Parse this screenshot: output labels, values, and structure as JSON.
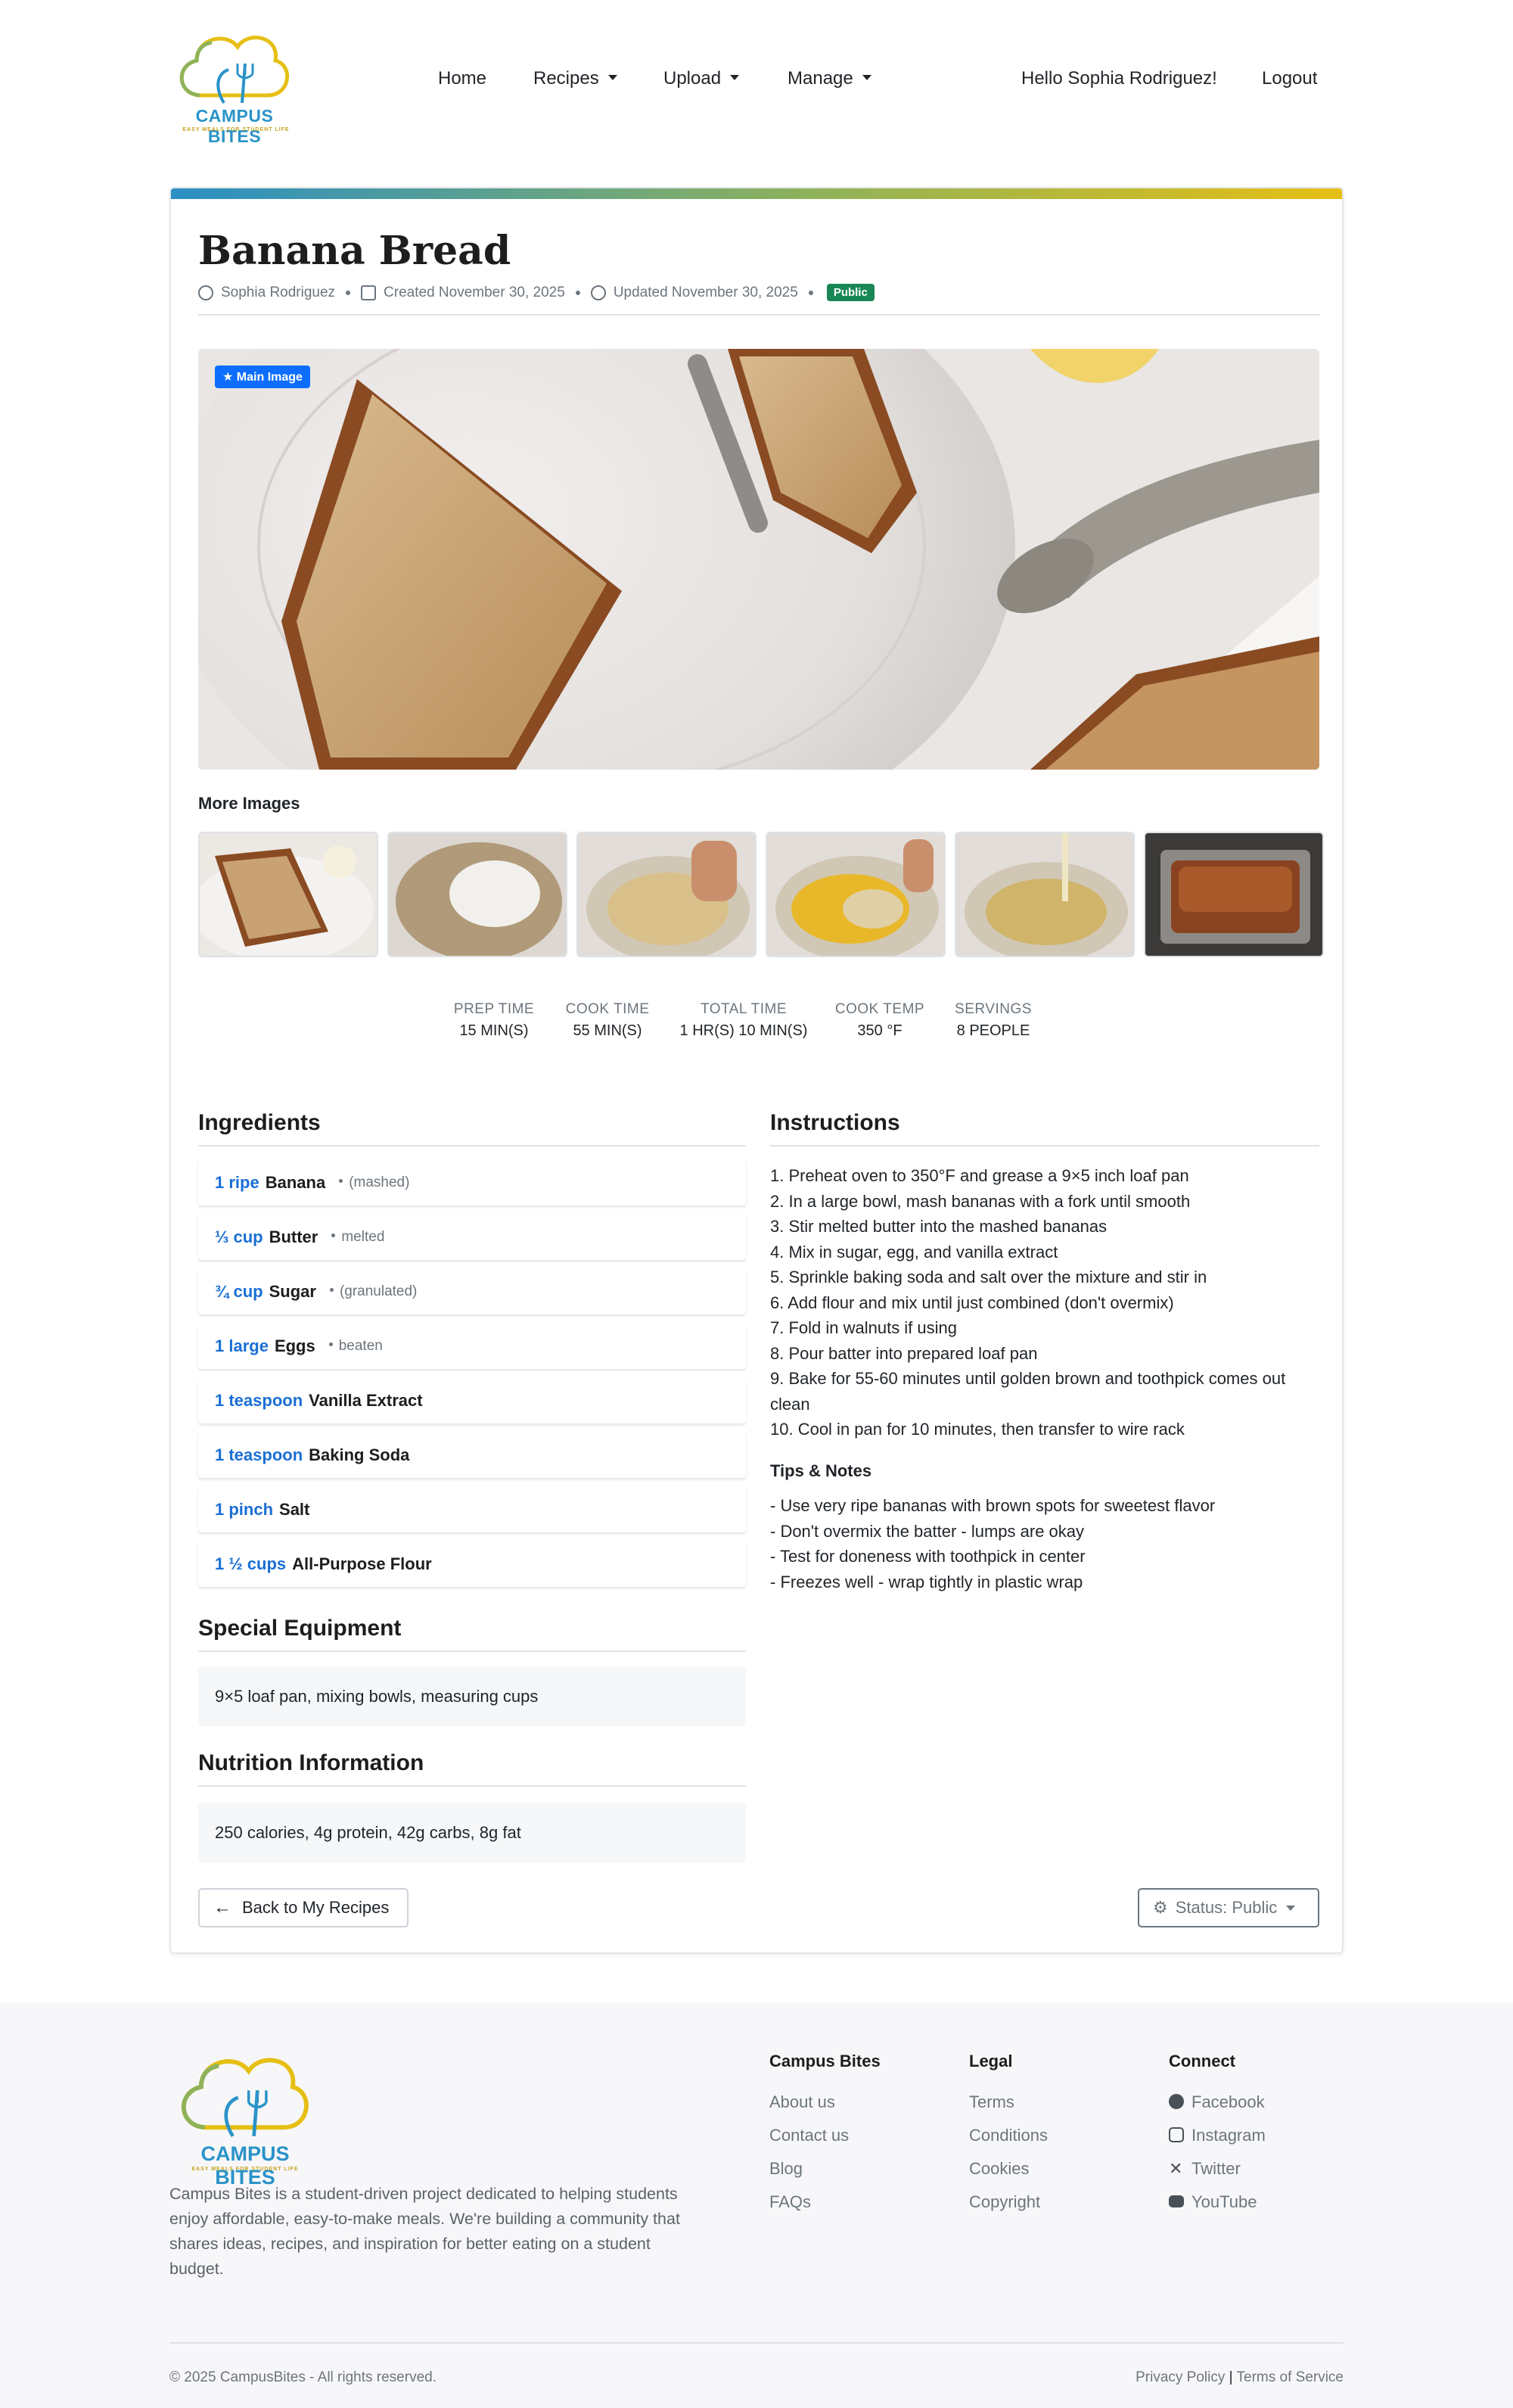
{
  "brand": {
    "name": "CAMPUS BITES",
    "tagline": "EASY MEALS FOR STUDENT LIFE",
    "colors": {
      "blue": "#2a93c9",
      "green": "#8fb25a",
      "gold": "#e6bf14"
    }
  },
  "nav": {
    "home": "Home",
    "recipes": "Recipes",
    "upload": "Upload",
    "manage": "Manage",
    "greeting": "Hello Sophia Rodriguez!",
    "logout": "Logout"
  },
  "recipe": {
    "title": "Banana Bread",
    "author": "Sophia Rodriguez",
    "created": "Created November 30, 2025",
    "updated": "Updated November 30, 2025",
    "visibility": "Public",
    "main_image_badge": "Main Image",
    "more_images_label": "More Images",
    "stats": [
      {
        "label": "PREP TIME",
        "value": "15 MIN(S)"
      },
      {
        "label": "COOK TIME",
        "value": "55 MIN(S)"
      },
      {
        "label": "TOTAL TIME",
        "value": "1 HR(S) 10 MIN(S)"
      },
      {
        "label": "COOK TEMP",
        "value": "350 °F"
      },
      {
        "label": "SERVINGS",
        "value": "8 PEOPLE"
      }
    ],
    "ingredients_title": "Ingredients",
    "ingredients": [
      {
        "amount": "1 ripe",
        "name": "Banana",
        "note": "(mashed)"
      },
      {
        "amount": "⅓ cup",
        "name": "Butter",
        "note": "melted"
      },
      {
        "amount": "¾ cup",
        "name": "Sugar",
        "note": "(granulated)"
      },
      {
        "amount": "1 large",
        "name": "Eggs",
        "note": "beaten"
      },
      {
        "amount": "1 teaspoon",
        "name": "Vanilla Extract",
        "note": ""
      },
      {
        "amount": "1 teaspoon",
        "name": "Baking Soda",
        "note": ""
      },
      {
        "amount": "1 pinch",
        "name": "Salt",
        "note": ""
      },
      {
        "amount": "1 ½ cups",
        "name": "All-Purpose Flour",
        "note": ""
      }
    ],
    "equipment_title": "Special Equipment",
    "equipment": "9×5 loaf pan, mixing bowls, measuring cups",
    "nutrition_title": "Nutrition Information",
    "nutrition": "250 calories, 4g protein, 42g carbs, 8g fat",
    "instructions_title": "Instructions",
    "instructions": [
      "1. Preheat oven to 350°F and grease a 9×5 inch loaf pan",
      "2. In a large bowl, mash bananas with a fork until smooth",
      "3. Stir melted butter into the mashed bananas",
      "4. Mix in sugar, egg, and vanilla extract",
      "5. Sprinkle baking soda and salt over the mixture and stir in",
      "6. Add flour and mix until just combined (don't overmix)",
      "7. Fold in walnuts if using",
      "8. Pour batter into prepared loaf pan",
      "9. Bake for 55-60 minutes until golden brown and toothpick comes out clean",
      "10. Cool in pan for 10 minutes, then transfer to wire rack"
    ],
    "tips_title": "Tips & Notes",
    "tips": [
      "- Use very ripe bananas with brown spots for sweetest flavor",
      "- Don't overmix the batter - lumps are okay",
      "- Test for doneness with toothpick in center",
      "- Freezes well - wrap tightly in plastic wrap"
    ],
    "back_button": "Back to My Recipes",
    "status_button": "Status: Public"
  },
  "footer": {
    "about": "Campus Bites is a student-driven project dedicated to helping students enjoy affordable, easy-to-make meals. We're building a community that shares ideas, recipes, and inspiration for better eating on a student budget.",
    "col1": {
      "title": "Campus Bites",
      "links": [
        "About us",
        "Contact us",
        "Blog",
        "FAQs"
      ]
    },
    "col2": {
      "title": "Legal",
      "links": [
        "Terms",
        "Conditions",
        "Cookies",
        "Copyright"
      ]
    },
    "col3": {
      "title": "Connect",
      "links": [
        "Facebook",
        "Instagram",
        "Twitter",
        "YouTube"
      ]
    },
    "copyright": "© 2025 CampusBites - All rights reserved.",
    "privacy": "Privacy Policy",
    "terms": "Terms of Service"
  }
}
